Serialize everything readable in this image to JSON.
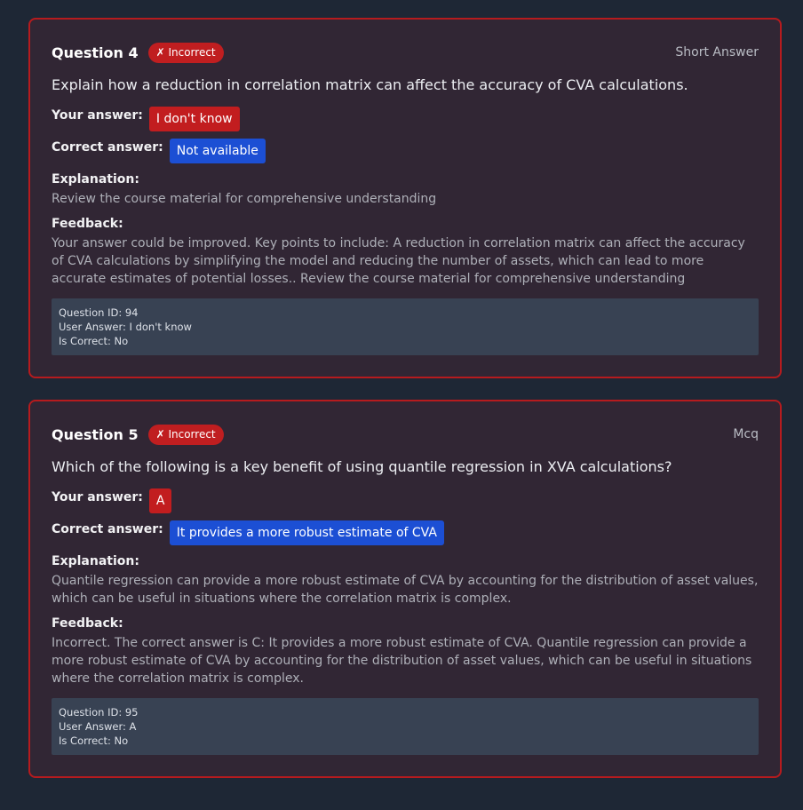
{
  "questions": [
    {
      "title": "Question 4",
      "status_badge": "✗ Incorrect",
      "type": "Short Answer",
      "text": "Explain how a reduction in correlation matrix can affect the accuracy of CVA calculations.",
      "your_answer_label": "Your answer:",
      "your_answer": "I don't know",
      "correct_answer_label": "Correct answer:",
      "correct_answer": "Not available",
      "explanation_label": "Explanation:",
      "explanation": "Review the course material for comprehensive understanding",
      "feedback_label": "Feedback:",
      "feedback": "Your answer could be improved. Key points to include: A reduction in correlation matrix can affect the accuracy of CVA calculations by simplifying the model and reducing the number of assets, which can lead to more accurate estimates of potential losses.. Review the course material for comprehensive understanding",
      "debug": {
        "question_id": "Question ID: 94",
        "user_answer": "User Answer: I don't know",
        "is_correct": "Is Correct: No"
      }
    },
    {
      "title": "Question 5",
      "status_badge": "✗ Incorrect",
      "type": "Mcq",
      "text": "Which of the following is a key benefit of using quantile regression in XVA calculations?",
      "your_answer_label": "Your answer:",
      "your_answer": "A",
      "correct_answer_label": "Correct answer:",
      "correct_answer": "It provides a more robust estimate of CVA",
      "explanation_label": "Explanation:",
      "explanation": "Quantile regression can provide a more robust estimate of CVA by accounting for the distribution of asset values, which can be useful in situations where the correlation matrix is complex.",
      "feedback_label": "Feedback:",
      "feedback": "Incorrect. The correct answer is C: It provides a more robust estimate of CVA. Quantile regression can provide a more robust estimate of CVA by accounting for the distribution of asset values, which can be useful in situations where the correlation matrix is complex.",
      "debug": {
        "question_id": "Question ID: 95",
        "user_answer": "User Answer: A",
        "is_correct": "Is Correct: No"
      }
    }
  ],
  "colors": {
    "page_bg": "#1e2735",
    "card_bg": "#312634",
    "card_border": "#b61b1e",
    "incorrect_red": "#c01e20",
    "correct_blue": "#1c4fd4",
    "debug_bg": "#384253"
  }
}
